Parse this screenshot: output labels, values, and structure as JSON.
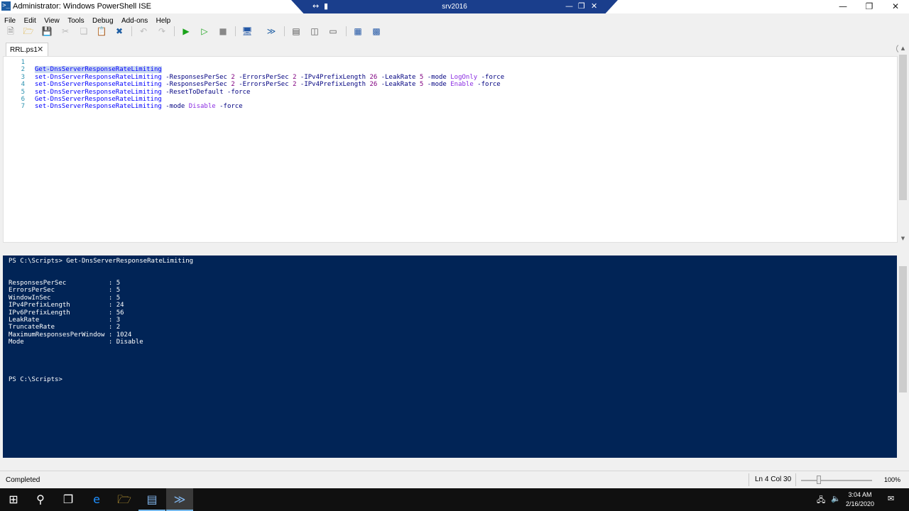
{
  "window": {
    "title": "Administrator: Windows PowerShell ISE",
    "app_icon": "powershell-ise-icon",
    "minimize_icon": "minimize-icon",
    "restore_icon": "restore-icon",
    "close_icon": "close-icon"
  },
  "rdp_bar": {
    "host": "srv2016",
    "pin_icon": "pin-icon",
    "signal_icon": "signal-icon"
  },
  "menu": {
    "items": [
      "File",
      "Edit",
      "View",
      "Tools",
      "Debug",
      "Add-ons",
      "Help"
    ]
  },
  "toolbar": {
    "icons": [
      "new-icon",
      "open-icon",
      "save-icon",
      "cut-icon",
      "copy-icon",
      "paste-icon",
      "clear-icon",
      "undo-icon",
      "redo-icon",
      "run-icon",
      "run-selection-icon",
      "stop-icon",
      "remote-icon",
      "powershell-icon",
      "layout-top-icon",
      "layout-right-icon",
      "layout-max-icon",
      "commands-icon",
      "addon-icon"
    ]
  },
  "tabs": [
    {
      "label": "RRL.ps1",
      "close": "✕"
    }
  ],
  "editor": {
    "line_numbers": [
      "1",
      "2",
      "3",
      "4",
      "5",
      "6",
      "7"
    ],
    "lines": [
      [],
      [
        {
          "t": "Get-DnsServerResponseRateLimiting",
          "c": "sel"
        }
      ],
      [
        {
          "t": "set-DnsServerResponseRateLimiting",
          "c": ""
        },
        {
          "t": " -ResponsesPerSec ",
          "c": "p"
        },
        {
          "t": "2",
          "c": "n"
        },
        {
          "t": " -ErrorsPerSec ",
          "c": "p"
        },
        {
          "t": "2",
          "c": "n"
        },
        {
          "t": " -IPv4PrefixLength ",
          "c": "p"
        },
        {
          "t": "26",
          "c": "n"
        },
        {
          "t": " -LeakRate ",
          "c": "p"
        },
        {
          "t": "5",
          "c": "n"
        },
        {
          "t": " -mode ",
          "c": "p"
        },
        {
          "t": "LogOnly",
          "c": "v"
        },
        {
          "t": " -force",
          "c": "p"
        }
      ],
      [
        {
          "t": "set-DnsServerResponseRateLimiting",
          "c": ""
        },
        {
          "t": " -ResponsesPerSec ",
          "c": "p"
        },
        {
          "t": "2",
          "c": "n"
        },
        {
          "t": " -ErrorsPerSec ",
          "c": "p"
        },
        {
          "t": "2",
          "c": "n"
        },
        {
          "t": " -IPv4PrefixLength ",
          "c": "p"
        },
        {
          "t": "26",
          "c": "n"
        },
        {
          "t": " -LeakRate ",
          "c": "p"
        },
        {
          "t": "5",
          "c": "n"
        },
        {
          "t": " -mode ",
          "c": "p"
        },
        {
          "t": "Enable",
          "c": "v"
        },
        {
          "t": " -force",
          "c": "p"
        }
      ],
      [
        {
          "t": "set-DnsServerResponseRateLimiting",
          "c": ""
        },
        {
          "t": " -ResetToDefault -force",
          "c": "p"
        }
      ],
      [
        {
          "t": "Get-DnsServerResponseRateLimiting",
          "c": ""
        }
      ],
      [
        {
          "t": "set-DnsServerResponseRateLimiting",
          "c": ""
        },
        {
          "t": " -mode ",
          "c": "p"
        },
        {
          "t": "Disable",
          "c": "v"
        },
        {
          "t": " -force",
          "c": "p"
        }
      ]
    ]
  },
  "console": {
    "command_line": "PS C:\\Scripts> Get-DnsServerResponseRateLimiting",
    "output": [
      "ResponsesPerSec           : 5",
      "ErrorsPerSec              : 5",
      "WindowInSec               : 5",
      "IPv4PrefixLength          : 24",
      "IPv6PrefixLength          : 56",
      "LeakRate                  : 3",
      "TruncateRate              : 2",
      "MaximumResponsesPerWindow : 1024",
      "Mode                      : Disable"
    ],
    "prompt": "PS C:\\Scripts>"
  },
  "status": {
    "text": "Completed",
    "position": "Ln 4  Col 30",
    "zoom": "100%"
  },
  "taskbar": {
    "apps": [
      "start-icon",
      "search-icon",
      "task-view-icon",
      "internet-explorer-icon",
      "file-explorer-icon",
      "server-manager-icon",
      "powershell-ise-icon"
    ],
    "time": "3:04 AM",
    "date": "2/16/2020",
    "tray_icons": [
      "network-icon",
      "volume-icon",
      "notification-icon"
    ]
  },
  "colors": {
    "console_bg": "#012456",
    "rdp_bar": "#1a3e8c",
    "selection": "#c9d7f1",
    "line_number": "#2b91af"
  }
}
